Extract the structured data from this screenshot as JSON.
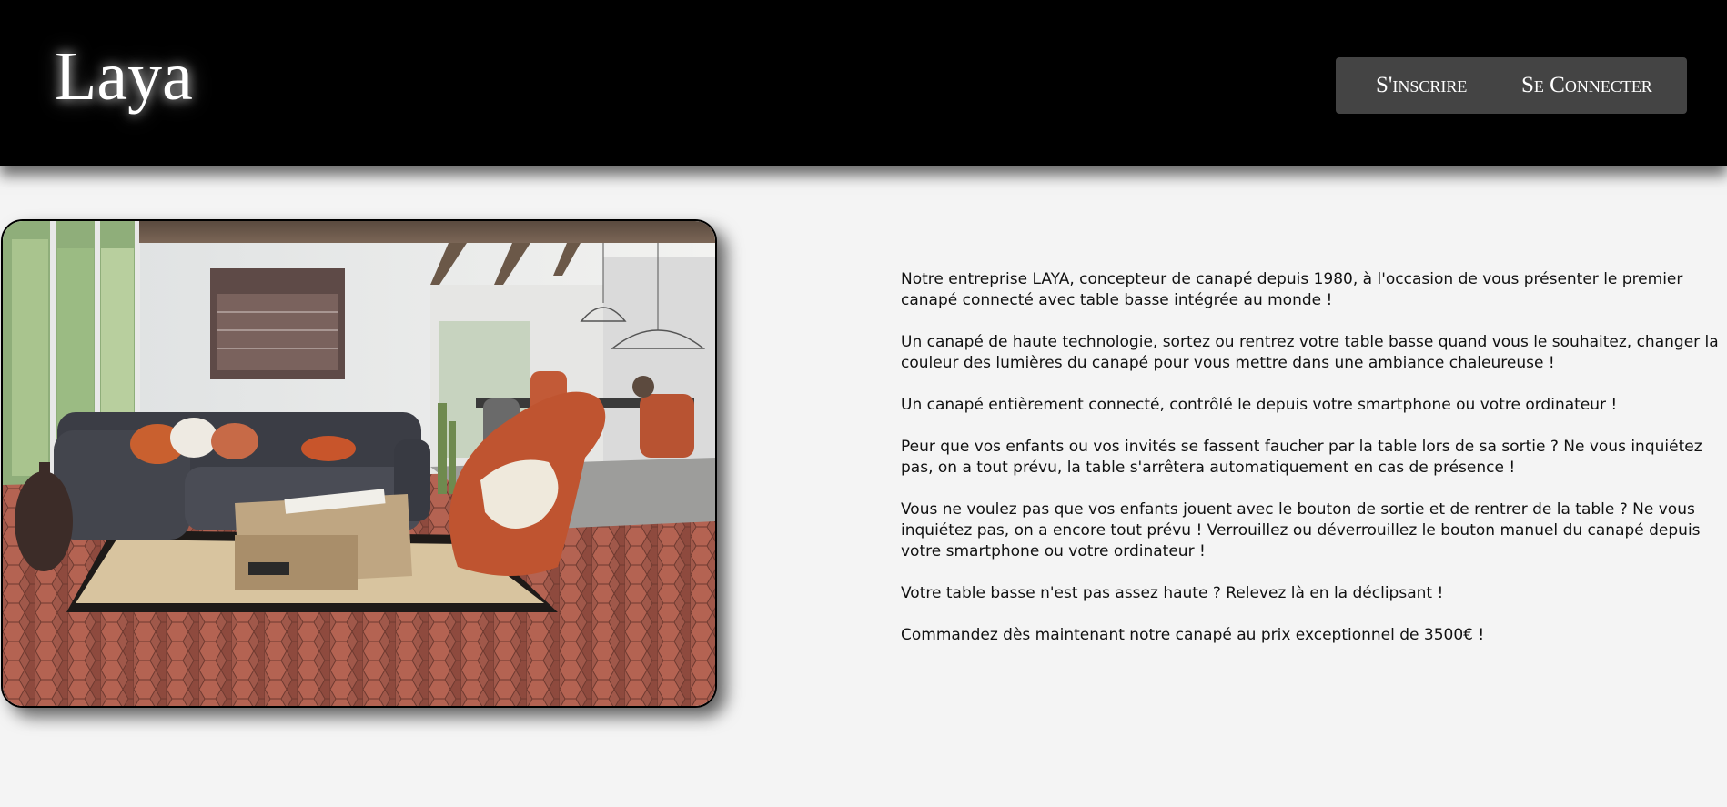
{
  "header": {
    "logo": "Laya",
    "signup_label": "S'inscrire",
    "login_label": "Se Connecter"
  },
  "hero": {
    "image_alt": "Salon avec canapé gris, table basse et fauteuil orange"
  },
  "content": {
    "paragraphs": [
      "Notre entreprise LAYA, concepteur de canapé depuis 1980, à l'occasion de vous présenter le premier canapé connecté avec table basse intégrée au monde !",
      "Un canapé de haute technologie, sortez ou rentrez votre table basse quand vous le souhaitez, changer la couleur des lumières du canapé pour vous mettre dans une ambiance chaleureuse !",
      "Un canapé entièrement connecté, contrôlé le depuis votre smartphone ou votre ordinateur !",
      "Peur que vos enfants ou vos invités se fassent faucher par la table lors de sa sortie ? Ne vous inquiétez pas, on a tout prévu, la table s'arrêtera automatiquement en cas de présence !",
      "Vous ne voulez pas que vos enfants jouent avec le bouton de sortie et de rentrer de la table ? Ne vous inquiétez pas, on a encore tout prévu ! Verrouillez ou déverrouillez le bouton manuel du canapé depuis votre smartphone ou votre ordinateur !",
      "Votre table basse n'est pas assez haute ? Relevez là en la déclipsant !",
      "Commandez dès maintenant notre canapé au prix exceptionnel de 3500€ !"
    ]
  },
  "colors": {
    "header_bg": "#000000",
    "auth_bg": "#444444",
    "page_bg": "#f4f4f4",
    "text": "#111111"
  }
}
